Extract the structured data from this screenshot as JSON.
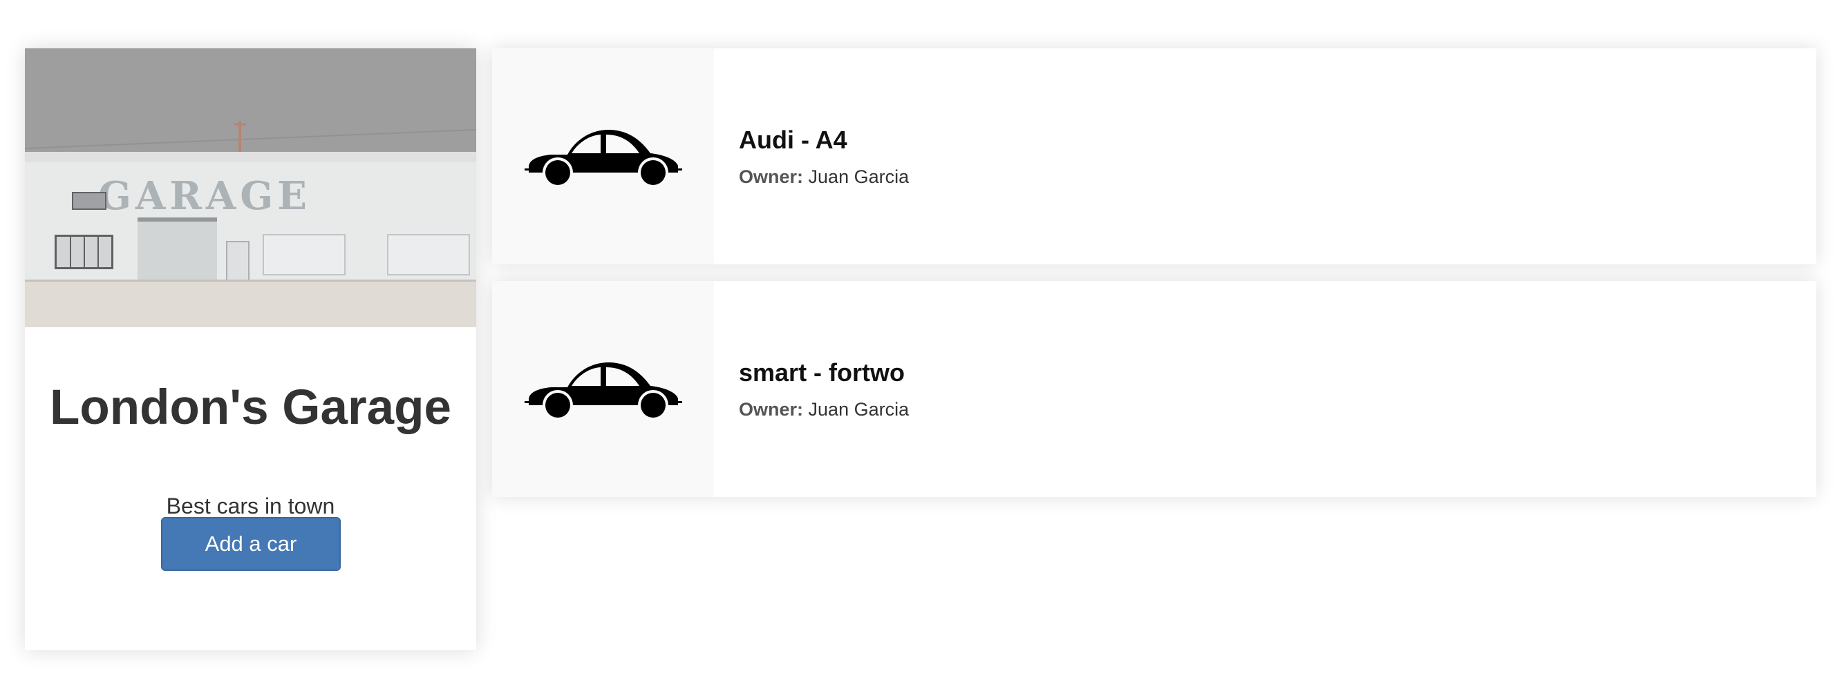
{
  "garage": {
    "name": "London's Garage",
    "tagline": "Best cars in town",
    "add_button_label": "Add a car",
    "banner_sign_text": "GARAGE"
  },
  "cars": [
    {
      "title": "Audi - A4",
      "owner_label": "Owner:",
      "owner_name": "Juan Garcia",
      "icon": "car-icon"
    },
    {
      "title": "smart - fortwo",
      "owner_label": "Owner:",
      "owner_name": "Juan Garcia",
      "icon": "car-icon"
    }
  ],
  "colors": {
    "primary_button": "#4479b6",
    "thumb_background": "#f9f9f9"
  }
}
